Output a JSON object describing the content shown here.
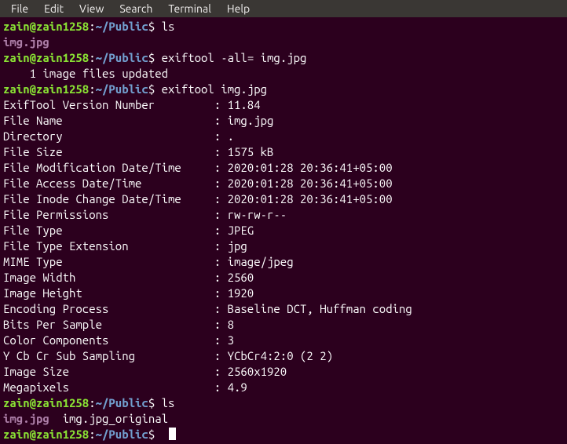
{
  "menu": {
    "file": "File",
    "edit": "Edit",
    "view": "View",
    "search": "Search",
    "terminal": "Terminal",
    "help": "Help"
  },
  "prompt": {
    "userhost": "zain@zain1258",
    "colon": ":",
    "path": "~/Public",
    "sigil": "$"
  },
  "cmds": {
    "ls": "ls",
    "exiftool_clear": "exiftool -all= img.jpg",
    "exiftool_show": "exiftool img.jpg",
    "ls2": "ls",
    "empty": " "
  },
  "out": {
    "img_file": "img.jpg",
    "updated": "    1 image files updated",
    "ls2_line": "  img.jpg_original"
  },
  "meta": [
    {
      "k": "ExifTool Version Number",
      "v": "11.84"
    },
    {
      "k": "File Name",
      "v": "img.jpg"
    },
    {
      "k": "Directory",
      "v": "."
    },
    {
      "k": "File Size",
      "v": "1575 kB"
    },
    {
      "k": "File Modification Date/Time",
      "v": "2020:01:28 20:36:41+05:00"
    },
    {
      "k": "File Access Date/Time",
      "v": "2020:01:28 20:36:41+05:00"
    },
    {
      "k": "File Inode Change Date/Time",
      "v": "2020:01:28 20:36:41+05:00"
    },
    {
      "k": "File Permissions",
      "v": "rw-rw-r--"
    },
    {
      "k": "File Type",
      "v": "JPEG"
    },
    {
      "k": "File Type Extension",
      "v": "jpg"
    },
    {
      "k": "MIME Type",
      "v": "image/jpeg"
    },
    {
      "k": "Image Width",
      "v": "2560"
    },
    {
      "k": "Image Height",
      "v": "1920"
    },
    {
      "k": "Encoding Process",
      "v": "Baseline DCT, Huffman coding"
    },
    {
      "k": "Bits Per Sample",
      "v": "8"
    },
    {
      "k": "Color Components",
      "v": "3"
    },
    {
      "k": "Y Cb Cr Sub Sampling",
      "v": "YCbCr4:2:0 (2 2)"
    },
    {
      "k": "Image Size",
      "v": "2560x1920"
    },
    {
      "k": "Megapixels",
      "v": "4.9"
    }
  ]
}
